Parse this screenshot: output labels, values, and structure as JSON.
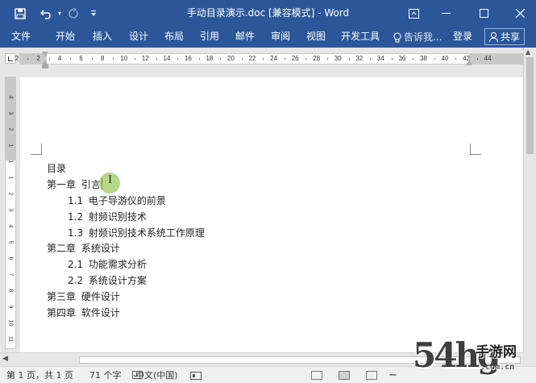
{
  "window": {
    "title": "手动目录演示.doc [兼容模式] - Word"
  },
  "quick_access": {
    "save_icon": "save-icon",
    "undo_icon": "undo-icon",
    "redo_icon": "redo-icon",
    "customize_icon": "customize-qat-icon"
  },
  "ribbon": {
    "file_label": "文件",
    "tabs": [
      "开始",
      "插入",
      "设计",
      "布局",
      "引用",
      "邮件",
      "审阅",
      "视图",
      "开发工具"
    ],
    "tell_me_label": "告诉我...",
    "signin_label": "登录",
    "share_label": "共享"
  },
  "ruler": {
    "horizontal_ticks": [
      "2",
      "2",
      "4",
      "6",
      "8",
      "10",
      "12",
      "14",
      "16",
      "18",
      "20",
      "22",
      "24",
      "26",
      "28",
      "30",
      "32",
      "34",
      "36",
      "38",
      "40",
      "42",
      "44"
    ],
    "vertical_ticks": [
      "4",
      "3",
      "2",
      "1",
      "1",
      "1",
      "2",
      "3",
      "4",
      "5",
      "6",
      "7",
      "8",
      "9",
      "10",
      "11",
      "12"
    ]
  },
  "document": {
    "toc_title": "目录",
    "lines": [
      {
        "num": "第一章",
        "text": "引言",
        "level": 1
      },
      {
        "num": "1.1",
        "text": "电子导游仪的前景",
        "level": 2
      },
      {
        "num": "1.2",
        "text": "射频识别技术",
        "level": 2
      },
      {
        "num": "1.3",
        "text": "射频识别技术系统工作原理",
        "level": 2
      },
      {
        "num": "第二章",
        "text": "系统设计",
        "level": 1
      },
      {
        "num": "2.1",
        "text": "功能需求分析",
        "level": 2
      },
      {
        "num": "2.2",
        "text": "系统设计方案",
        "level": 2
      },
      {
        "num": "第三章",
        "text": "硬件设计",
        "level": 1
      },
      {
        "num": "第四章",
        "text": "软件设计",
        "level": 1
      }
    ]
  },
  "status": {
    "page": "第 1 页，共 1 页",
    "words": "71 个字",
    "language": "中文(中国)"
  },
  "watermark": {
    "number": "54hg",
    "site_cn": "手游网",
    "url": ".com.cn"
  },
  "colors": {
    "ribbon": "#2b579a",
    "highlight_halo": "#96c85a"
  }
}
